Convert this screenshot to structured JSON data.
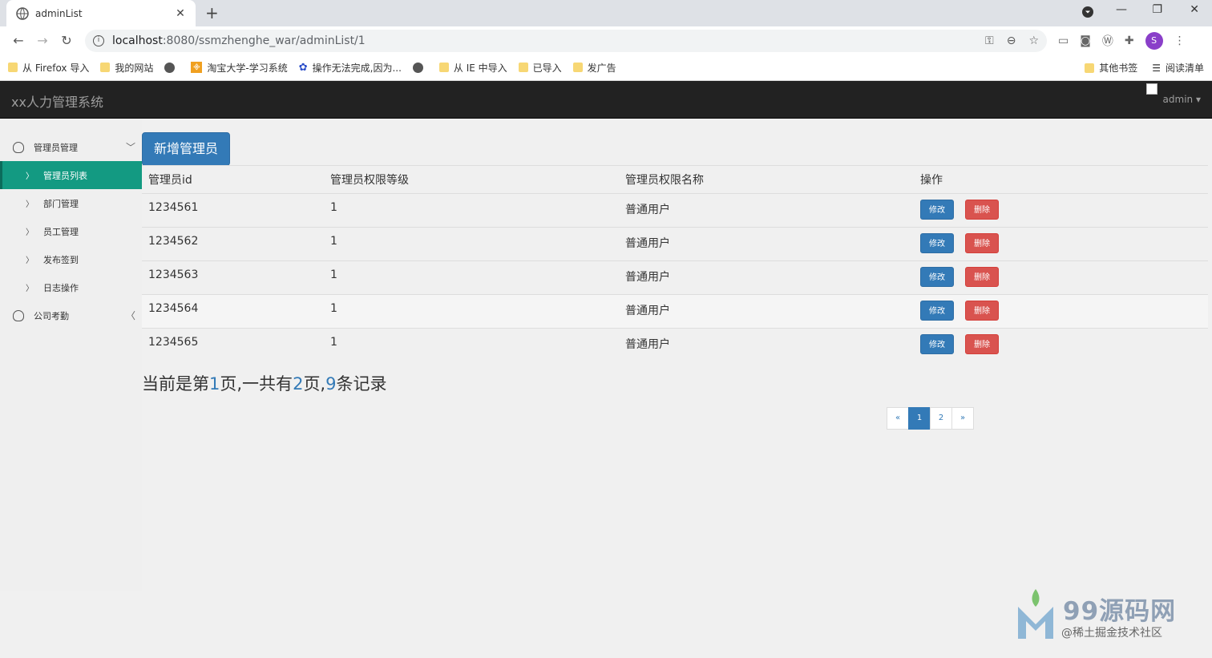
{
  "browser": {
    "tab_title": "adminList",
    "url_host": "localhost",
    "url_path": ":8080/ssmzhenghe_war/adminList/1",
    "avatar_letter": "S",
    "bookmarks": [
      {
        "icon": "folder",
        "label": "从 Firefox 导入"
      },
      {
        "icon": "folder",
        "label": "我的网站"
      },
      {
        "icon": "globe",
        "label": ""
      },
      {
        "icon": "rss",
        "label": "淘宝大学-学习系统"
      },
      {
        "icon": "paw",
        "label": "操作无法完成,因为..."
      },
      {
        "icon": "globe",
        "label": ""
      },
      {
        "icon": "folder",
        "label": "从 IE 中导入"
      },
      {
        "icon": "folder",
        "label": "已导入"
      },
      {
        "icon": "folder",
        "label": "发广告"
      }
    ],
    "bookmarks_right": [
      "其他书签",
      "阅读清单"
    ]
  },
  "header": {
    "brand": "xx人力管理系统",
    "user": "admin"
  },
  "sidebar": {
    "group1": "管理员管理",
    "items": [
      "管理员列表",
      "部门管理",
      "员工管理",
      "发布签到",
      "日志操作"
    ],
    "group2": "公司考勤"
  },
  "main": {
    "add_button": "新增管理员",
    "columns": [
      "管理员id",
      "管理员权限等级",
      "管理员权限名称",
      "操作"
    ],
    "rows": [
      [
        "1234561",
        "1",
        "普通用户"
      ],
      [
        "1234562",
        "1",
        "普通用户"
      ],
      [
        "1234563",
        "1",
        "普通用户"
      ],
      [
        "1234564",
        "1",
        "普通用户"
      ],
      [
        "1234565",
        "1",
        "普通用户"
      ]
    ],
    "edit_label": "修改",
    "delete_label": "删除",
    "page_info": {
      "prefix": "当前是第",
      "current": "1",
      "mid1": "页,一共有",
      "total_pages": "2",
      "mid2": "页,",
      "total_records": "9",
      "suffix": "条记录"
    },
    "pager": [
      "«",
      "1",
      "2",
      "»"
    ]
  },
  "watermark": {
    "title": "99源码网",
    "subtitle": "@稀土掘金技术社区"
  }
}
